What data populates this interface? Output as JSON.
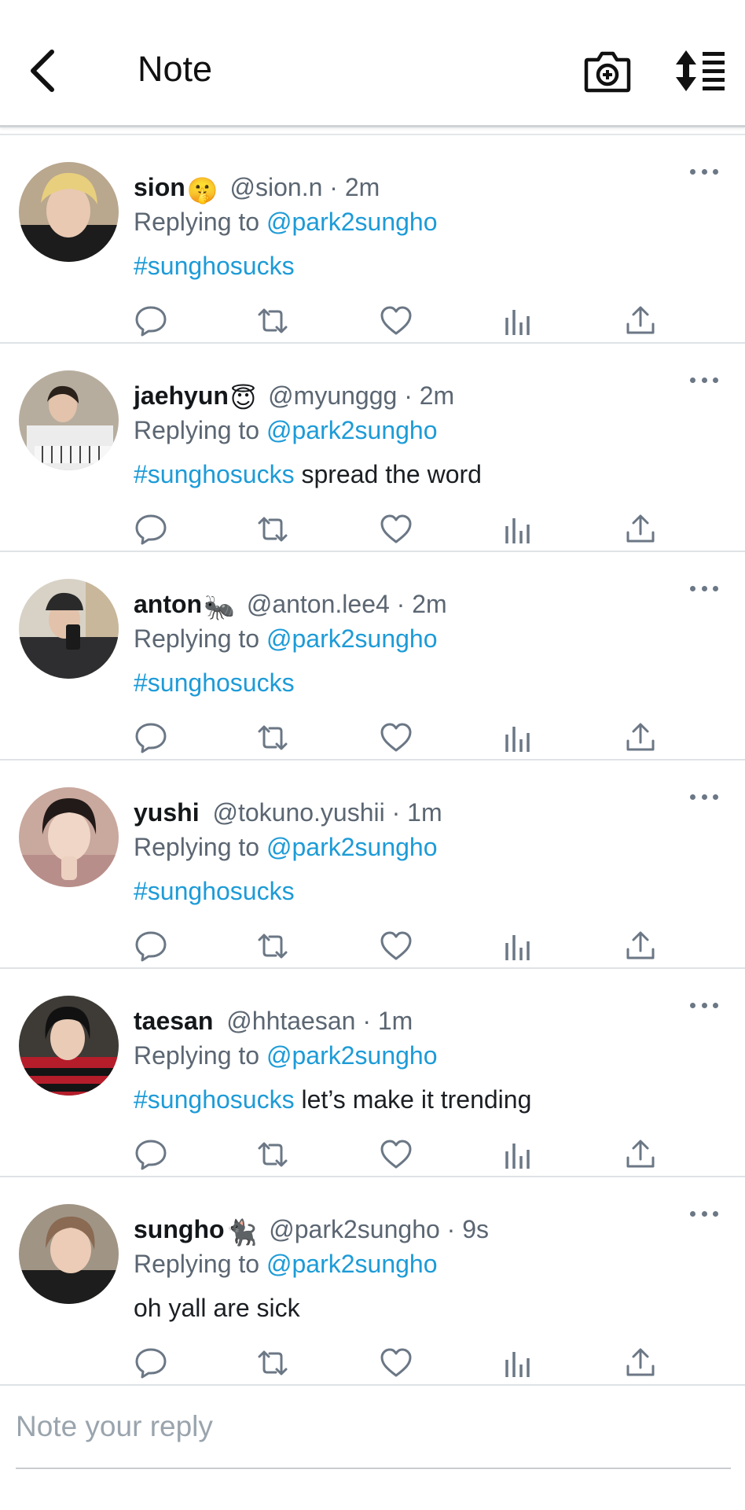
{
  "header": {
    "title": "Note",
    "back_icon": "chevron-left-icon",
    "camera_icon": "camera-plus-icon",
    "sort_icon": "sort-list-icon"
  },
  "colors": {
    "link": "#1d9bd7",
    "secondary_text": "#5b6672",
    "icon": "#6b7785",
    "divider": "#dfe3e6"
  },
  "tweets": [
    {
      "name": "sion",
      "emoji": "🤫",
      "handle": "@sion.n",
      "time": "2m",
      "replying_label": "Replying to",
      "replying_to": "@park2sungho",
      "hashtag": "#sunghosucks",
      "text": ""
    },
    {
      "name": "jaehyun",
      "emoji": "😇",
      "handle": "@myunggg",
      "time": "2m",
      "replying_label": "Replying to",
      "replying_to": "@park2sungho",
      "hashtag": "#sunghosucks",
      "text": "spread the word"
    },
    {
      "name": "anton",
      "emoji": "🐜",
      "handle": "@anton.lee4",
      "time": "2m",
      "replying_label": "Replying to",
      "replying_to": "@park2sungho",
      "hashtag": "#sunghosucks",
      "text": ""
    },
    {
      "name": "yushi",
      "emoji": "",
      "handle": "@tokuno.yushii",
      "time": "1m",
      "replying_label": "Replying to",
      "replying_to": "@park2sungho",
      "hashtag": "#sunghosucks",
      "text": ""
    },
    {
      "name": "taesan",
      "emoji": "",
      "handle": "@hhtaesan",
      "time": "1m",
      "replying_label": "Replying to",
      "replying_to": "@park2sungho",
      "hashtag": "#sunghosucks",
      "text": "let’s make it trending"
    },
    {
      "name": "sungho",
      "emoji": "🐈‍⬛",
      "handle": "@park2sungho",
      "time": "9s",
      "replying_label": "Replying to",
      "replying_to": "@park2sungho",
      "hashtag": "",
      "text": "oh yall are sick"
    }
  ],
  "action_icons": [
    "reply-icon",
    "retweet-icon",
    "like-icon",
    "stats-icon",
    "share-icon"
  ],
  "reply_box": {
    "placeholder": "Note your reply",
    "value": ""
  }
}
